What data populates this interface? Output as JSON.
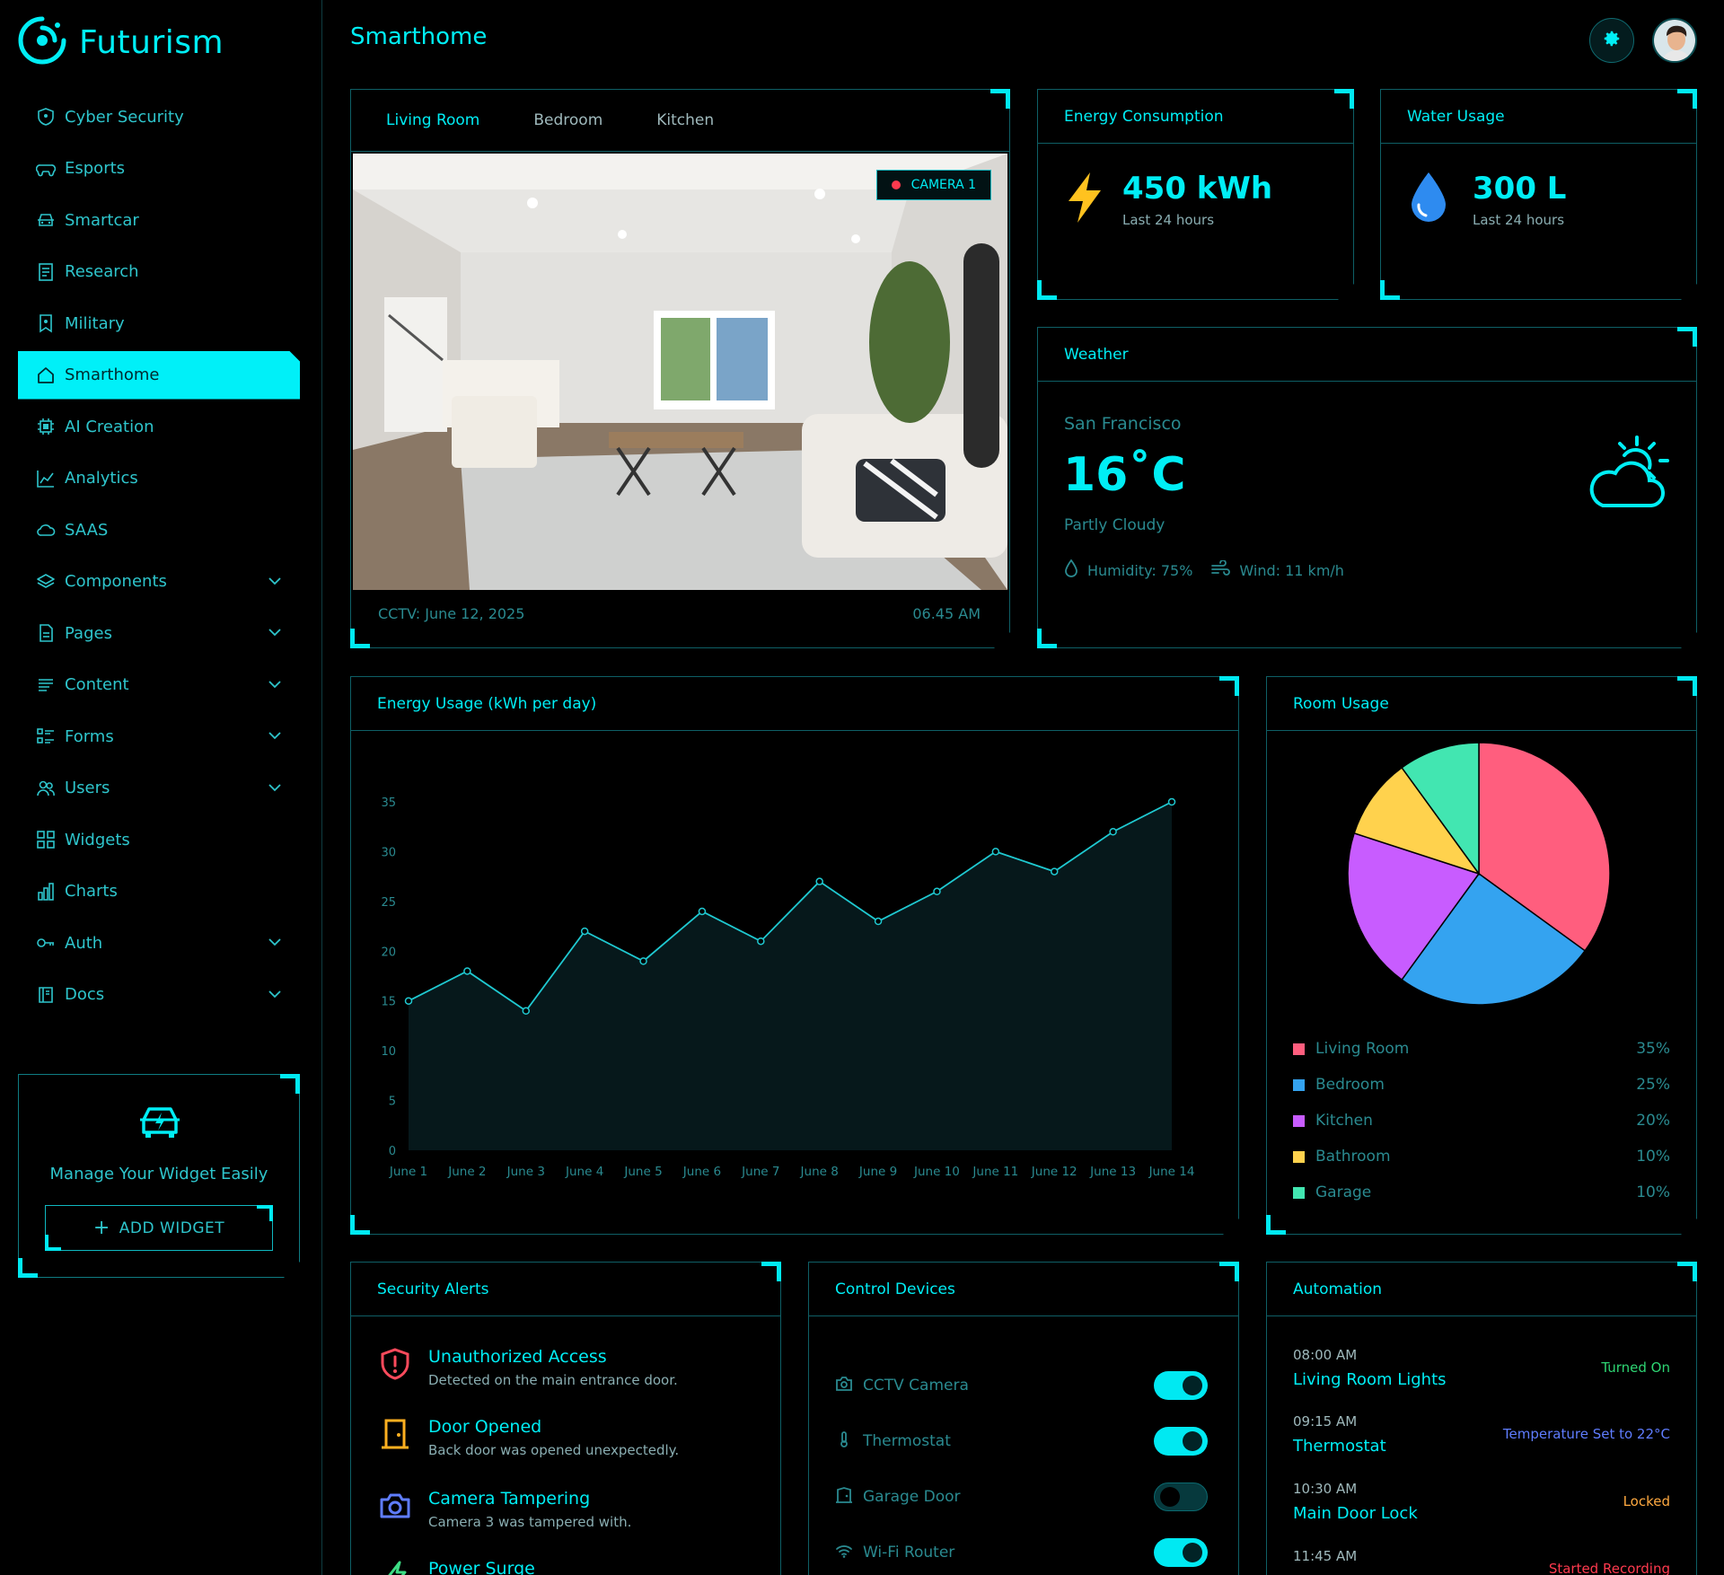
{
  "app": {
    "name": "Futurism",
    "page_title": "Smarthome"
  },
  "sidebar": {
    "items": [
      {
        "label": "Cyber Security",
        "icon": "shield-icon",
        "expandable": false
      },
      {
        "label": "Esports",
        "icon": "gamepad-icon",
        "expandable": false
      },
      {
        "label": "Smartcar",
        "icon": "car-icon",
        "expandable": false
      },
      {
        "label": "Research",
        "icon": "document-list-icon",
        "expandable": false
      },
      {
        "label": "Military",
        "icon": "bookmark-star-icon",
        "expandable": false
      },
      {
        "label": "Smarthome",
        "icon": "home-icon",
        "expandable": false,
        "active": true
      },
      {
        "label": "AI Creation",
        "icon": "chip-icon",
        "expandable": false
      },
      {
        "label": "Analytics",
        "icon": "line-chart-icon",
        "expandable": false
      },
      {
        "label": "SAAS",
        "icon": "cloud-icon",
        "expandable": false
      },
      {
        "label": "Components",
        "icon": "layers-icon",
        "expandable": true
      },
      {
        "label": "Pages",
        "icon": "page-icon",
        "expandable": true
      },
      {
        "label": "Content",
        "icon": "text-lines-icon",
        "expandable": true
      },
      {
        "label": "Forms",
        "icon": "form-icon",
        "expandable": true
      },
      {
        "label": "Users",
        "icon": "users-icon",
        "expandable": true
      },
      {
        "label": "Widgets",
        "icon": "grid-icon",
        "expandable": false
      },
      {
        "label": "Charts",
        "icon": "bar-chart-icon",
        "expandable": false
      },
      {
        "label": "Auth",
        "icon": "key-icon",
        "expandable": true
      },
      {
        "label": "Docs",
        "icon": "book-icon",
        "expandable": true
      }
    ],
    "widget_card": {
      "text": "Manage Your Widget Easily",
      "button": "ADD WIDGET"
    }
  },
  "camera": {
    "tabs": [
      "Living Room",
      "Bedroom",
      "Kitchen"
    ],
    "active_tab": "Living Room",
    "badge": "CAMERA 1",
    "footer_left": "CCTV: June 12, 2025",
    "footer_right": "06.45 AM"
  },
  "energy": {
    "title": "Energy Consumption",
    "value": "450 kWh",
    "sub": "Last 24 hours"
  },
  "water": {
    "title": "Water Usage",
    "value": "300 L",
    "sub": "Last 24 hours"
  },
  "weather": {
    "title": "Weather",
    "city": "San Francisco",
    "temp": "16˚C",
    "condition": "Partly Cloudy",
    "humidity": "Humidity: 75%",
    "wind": "Wind: 11 km/h"
  },
  "energy_usage": {
    "title": "Energy Usage (kWh per day)"
  },
  "room_usage": {
    "title": "Room Usage"
  },
  "chart_data": [
    {
      "type": "area",
      "title": "Energy Usage (kWh per day)",
      "categories": [
        "June 1",
        "June 2",
        "June 3",
        "June 4",
        "June 5",
        "June 6",
        "June 7",
        "June 8",
        "June 9",
        "June 10",
        "June 11",
        "June 12",
        "June 13",
        "June 14"
      ],
      "values": [
        15,
        18,
        14,
        22,
        19,
        24,
        21,
        27,
        23,
        26,
        30,
        28,
        32,
        35
      ],
      "ylim": [
        0,
        35
      ],
      "yticks": [
        0,
        5,
        10,
        15,
        20,
        25,
        30,
        35
      ],
      "color": "#1fc9d1"
    },
    {
      "type": "pie",
      "title": "Room Usage",
      "labels": [
        "Living Room",
        "Bedroom",
        "Kitchen",
        "Bathroom",
        "Garage"
      ],
      "values": [
        35,
        25,
        20,
        10,
        10
      ],
      "display": [
        "35%",
        "25%",
        "20%",
        "10%",
        "10%"
      ],
      "colors": [
        "#ff5e7e",
        "#34a3f0",
        "#c85cff",
        "#ffd24d",
        "#42e6b1"
      ]
    }
  ],
  "security": {
    "title": "Security Alerts",
    "alerts": [
      {
        "title": "Unauthorized Access",
        "desc": "Detected on the main entrance door.",
        "icon": "shield-alert-icon",
        "color": "#ff4a5c"
      },
      {
        "title": "Door Opened",
        "desc": "Back door was opened unexpectedly.",
        "icon": "door-icon",
        "color": "#ffb020"
      },
      {
        "title": "Camera Tampering",
        "desc": "Camera 3 was tampered with.",
        "icon": "camera-icon",
        "color": "#5f7dff"
      },
      {
        "title": "Power Surge",
        "desc": "",
        "icon": "bolt-icon",
        "color": "#3ddc84"
      }
    ]
  },
  "devices": {
    "title": "Control Devices",
    "items": [
      {
        "label": "CCTV Camera",
        "icon": "camera-icon",
        "on": true
      },
      {
        "label": "Thermostat",
        "icon": "thermometer-icon",
        "on": true
      },
      {
        "label": "Garage Door",
        "icon": "garage-door-icon",
        "on": false
      },
      {
        "label": "Wi-Fi Router",
        "icon": "wifi-icon",
        "on": true
      }
    ]
  },
  "automation": {
    "title": "Automation",
    "items": [
      {
        "time": "08:00 AM",
        "name": "Living Room Lights",
        "status": "Turned On",
        "color": "#2ed573"
      },
      {
        "time": "09:15 AM",
        "name": "Thermostat",
        "status": "Temperature Set to 22°C",
        "color": "#5f7dff"
      },
      {
        "time": "10:30 AM",
        "name": "Main Door Lock",
        "status": "Locked",
        "color": "#ffa940"
      },
      {
        "time": "11:45 AM",
        "name": "",
        "status": "Started Recording",
        "color": "#ff3a4e"
      }
    ]
  }
}
